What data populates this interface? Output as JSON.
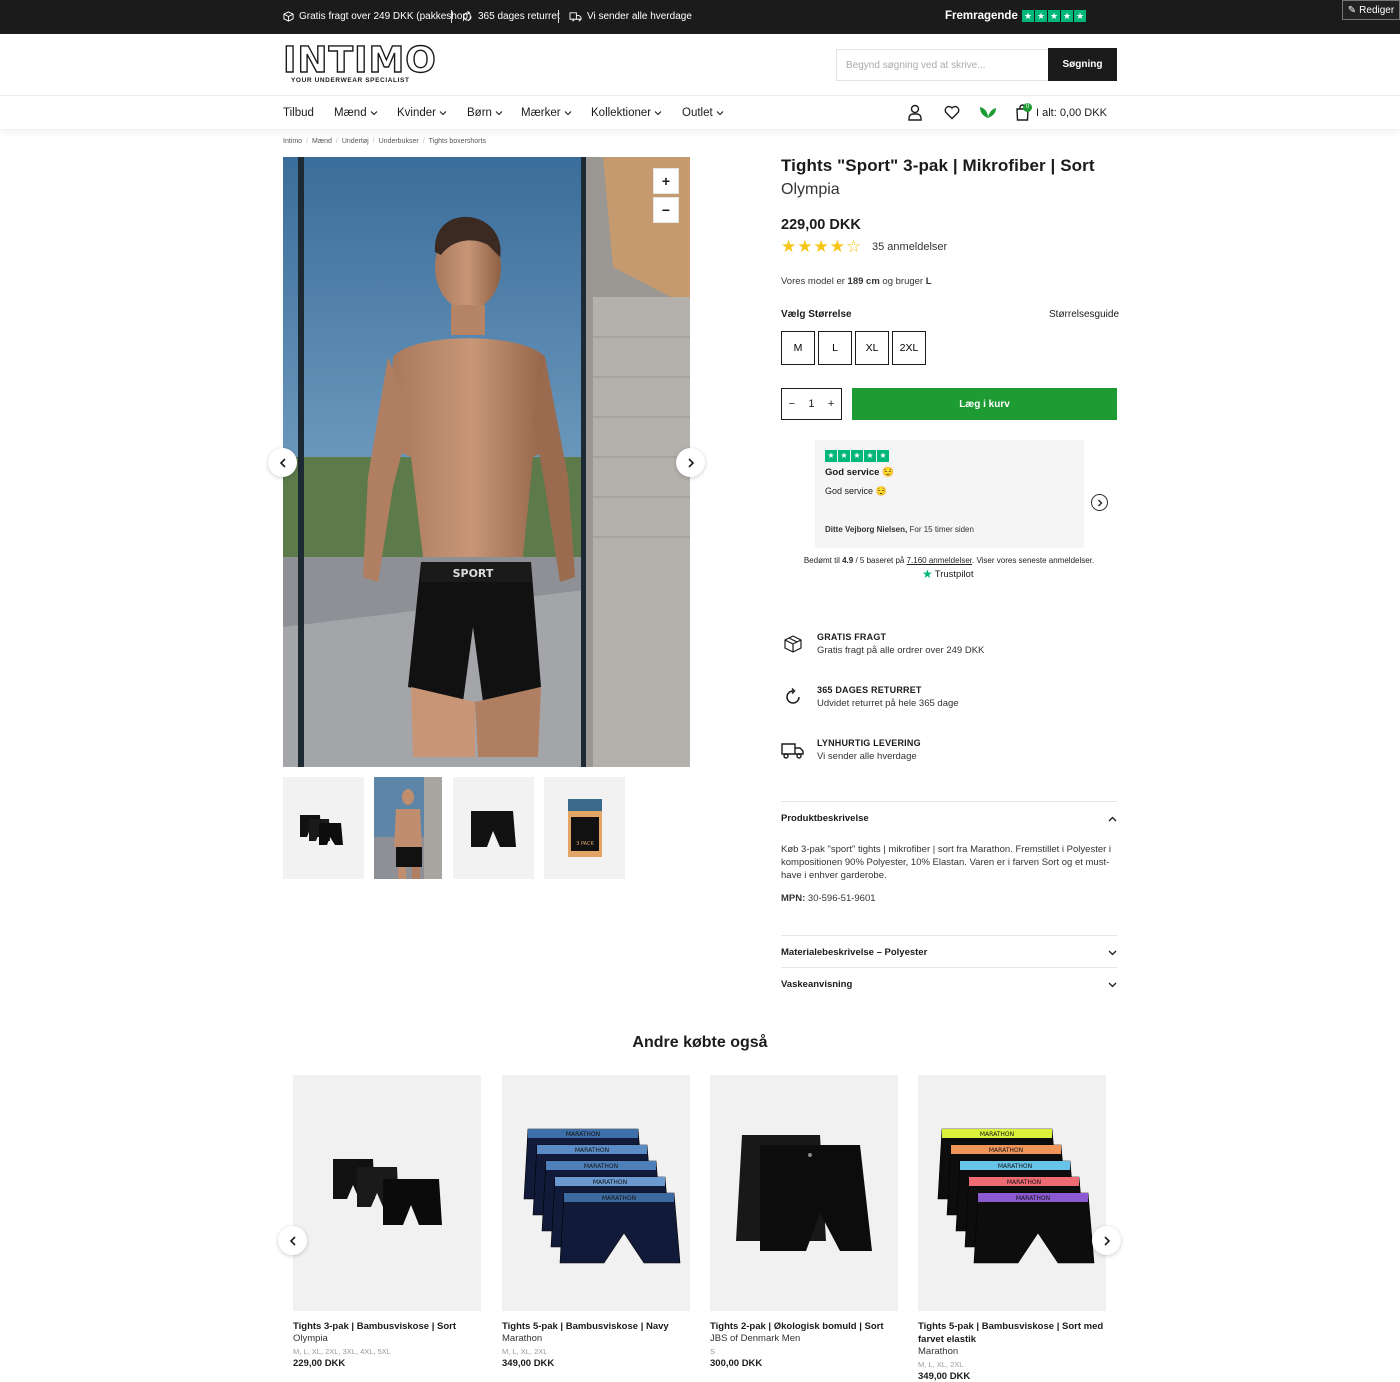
{
  "topbar": {
    "usp1": "Gratis fragt over 249 DKK (pakkeshop)",
    "usp2": "365 dages returret",
    "usp3": "Vi sender alle hverdage",
    "trustpilot_label": "Fremragende",
    "edit_label": "Rediger"
  },
  "header": {
    "logo": "INTIMO",
    "logo_tagline": "YOUR UNDERWEAR SPECIALIST",
    "search_placeholder": "Begynd søgning ved at skrive...",
    "search_button": "Søgning"
  },
  "nav": {
    "items": [
      "Tilbud",
      "Mænd",
      "Kvinder",
      "Børn",
      "Mærker",
      "Kollektioner",
      "Outlet"
    ],
    "cart_count": "0",
    "cart_total": "I alt: 0,00 DKK"
  },
  "breadcrumb": [
    "Intimo",
    "Mænd",
    "Undertøj",
    "Underbukser",
    "Tights boxershorts"
  ],
  "gallery": {
    "zoom_in": "+",
    "zoom_out": "−",
    "thumb_pack_label": "3 PACK"
  },
  "product": {
    "title": "Tights \"Sport\" 3-pak | Mikrofiber | Sort",
    "brand": "Olympia",
    "price": "229,00 DKK",
    "rating": 4,
    "rating_max": 5,
    "reviews": "35 anmeldelser",
    "model_prefix": "Vores model er",
    "model_height": "189 cm",
    "model_mid": "og bruger",
    "model_size": "L",
    "size_label": "Vælg Størrelse",
    "size_guide": "Størrelsesguide",
    "sizes": [
      "M",
      "L",
      "XL",
      "2XL"
    ],
    "qty": "1",
    "add_to_cart": "Læg i kurv"
  },
  "trustpilot": {
    "review_title": "God service 😌",
    "review_body": "God service 😌",
    "review_author": "Ditte Vejborg Nielsen,",
    "review_time": "For 15 timer siden",
    "summary_pre": "Bedømt til",
    "score": "4.9",
    "summary_mid": "/ 5 baseret på",
    "count": "7.160 anmeldelser",
    "summary_post": ". Viser vores seneste anmeldelser.",
    "brand": "Trustpilot"
  },
  "usps": [
    {
      "title": "GRATIS FRAGT",
      "desc": "Gratis fragt på alle ordrer over 249 DKK"
    },
    {
      "title": "365 DAGES RETURRET",
      "desc": "Udvidet returret på hele 365 dage"
    },
    {
      "title": "LYNHURTIG LEVERING",
      "desc": "Vi sender alle hverdage"
    }
  ],
  "accordion": {
    "desc_title": "Produktbeskrivelse",
    "desc_text": "Køb 3-pak \"sport\" tights | mikrofiber | sort fra Marathon. Fremstillet i Polyester i kompositionen 90% Polyester, 10% Elastan. Varen er i farven Sort og et must-have i enhver garderobe.",
    "mpn_label": "MPN:",
    "mpn_value": "30-596-51-9601",
    "material_title": "Materialebeskrivelse – Polyester",
    "wash_title": "Vaskeanvisning"
  },
  "related": {
    "title": "Andre købte også",
    "items": [
      {
        "name": "Tights 3-pak | Bambusviskose | Sort",
        "brand": "Olympia",
        "sizes": "M, L, XL, 2XL, 3XL, 4XL, 5XL",
        "price": "229,00 DKK"
      },
      {
        "name": "Tights 5-pak | Bambusviskose | Navy",
        "brand": "Marathon",
        "sizes": "M, L, XL, 2XL",
        "price": "349,00 DKK"
      },
      {
        "name": "Tights 2-pak | Økologisk bomuld | Sort",
        "brand": "JBS of Denmark Men",
        "sizes": "S",
        "price": "300,00 DKK"
      },
      {
        "name": "Tights 5-pak | Bambusviskose | Sort med farvet elastik",
        "brand": "Marathon",
        "sizes": "M, L, XL, 2XL",
        "price": "349,00 DKK"
      }
    ],
    "waistband_text": "MARATHON",
    "sport_text": "SPORT"
  },
  "colors": {
    "accent_green": "#1e9b32",
    "trustpilot_green": "#00b67a",
    "star_yellow": "#f5c518",
    "dark": "#1b1b1b"
  }
}
